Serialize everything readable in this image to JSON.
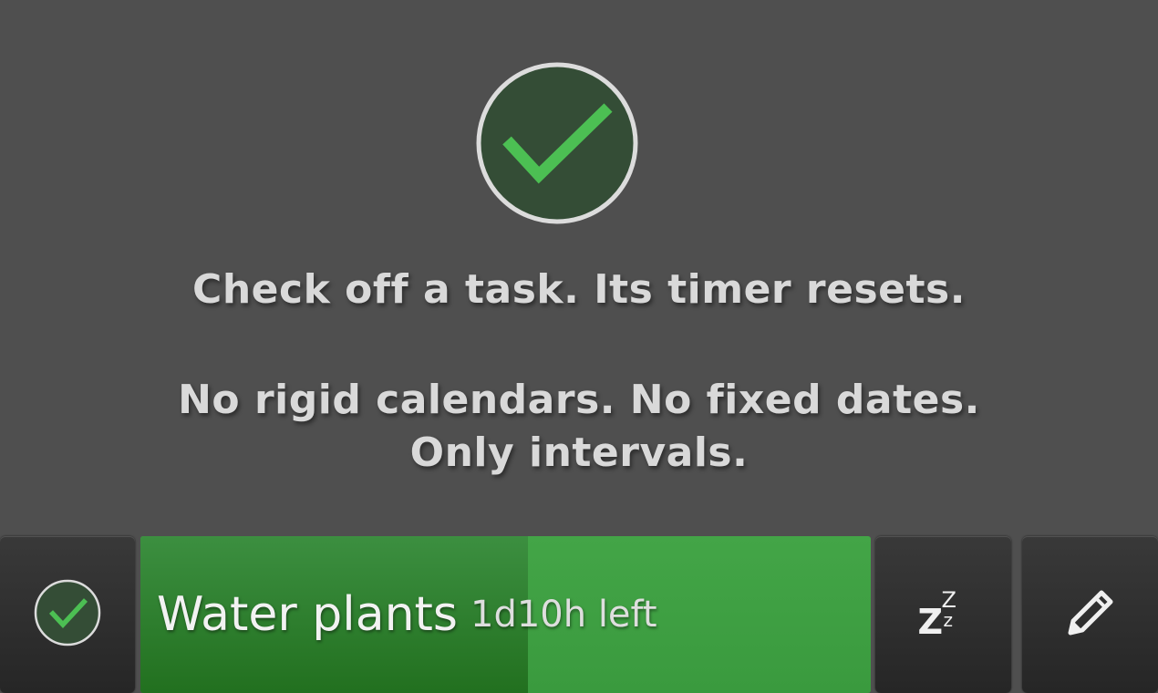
{
  "hero": {
    "icon": "checkmark-circle-icon",
    "circle_fill": "#344d36",
    "circle_stroke": "#dcdcdc",
    "check_color": "#4cbf53"
  },
  "message": {
    "line1": "Check off a task. Its timer resets.",
    "line2": "No rigid calendars. No fixed dates.",
    "line3": "Only intervals."
  },
  "task": {
    "name": "Water plants",
    "time_left": "1d10h left",
    "elapsed_fraction": 0.53,
    "bar_color": "#3d9c41",
    "elapsed_color": "#2e7f2c"
  },
  "actions": {
    "complete_icon": "checkmark-circle-icon",
    "snooze_icon": "snooze-zzz-icon",
    "snooze_glyphs": {
      "z1": "Z",
      "z2": "Z",
      "z3": "z"
    },
    "edit_icon": "pencil-icon"
  }
}
